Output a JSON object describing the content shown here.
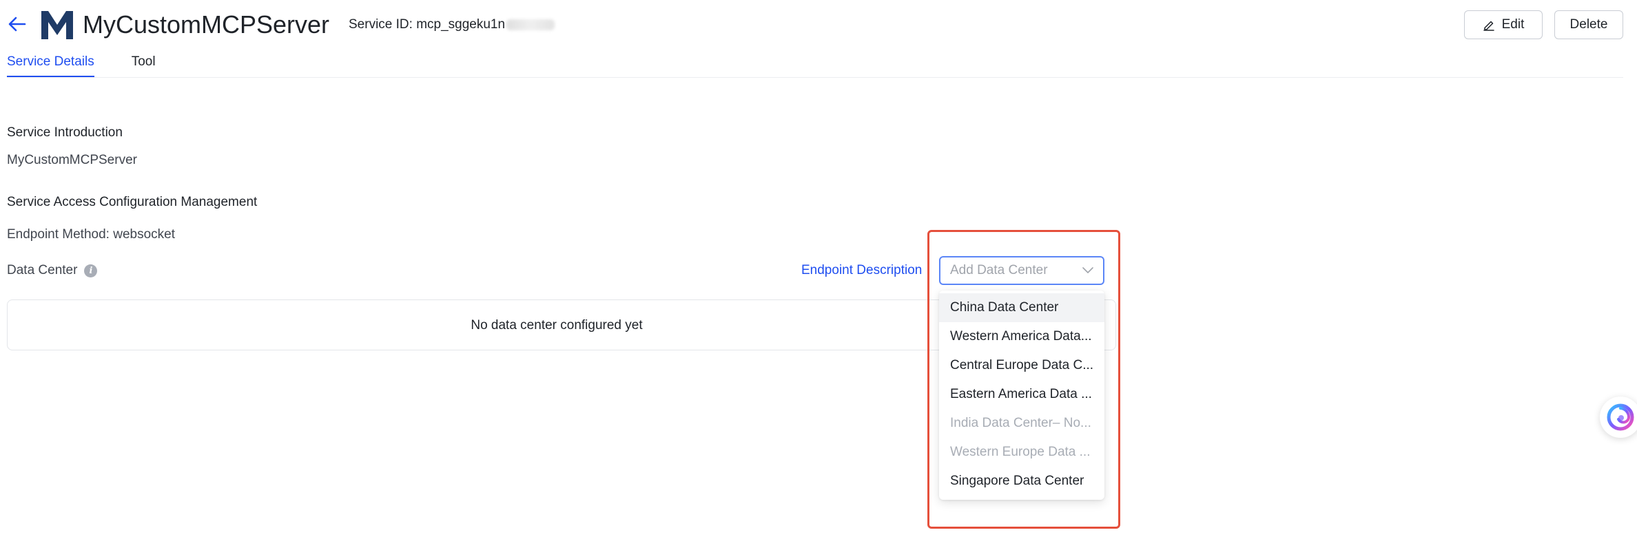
{
  "header": {
    "title": "MyCustomMCPServer",
    "service_id_label": "Service ID: mcp_sggeku1n",
    "logo_letter": "M",
    "edit_label": "Edit",
    "delete_label": "Delete"
  },
  "tabs": [
    {
      "label": "Service Details",
      "active": true
    },
    {
      "label": "Tool",
      "active": false
    }
  ],
  "service_intro": {
    "title": "Service Introduction",
    "value": "MyCustomMCPServer"
  },
  "access_config": {
    "title": "Service Access Configuration Management",
    "endpoint_method": "Endpoint Method: websocket",
    "data_center_label": "Data Center",
    "endpoint_description_link": "Endpoint Description",
    "empty_text": "No data center configured yet"
  },
  "data_center_select": {
    "placeholder": "Add Data Center",
    "options": [
      {
        "label": "China Data Center",
        "disabled": false,
        "hover": true
      },
      {
        "label": "Western America Data...",
        "disabled": false,
        "hover": false
      },
      {
        "label": "Central Europe Data C...",
        "disabled": false,
        "hover": false
      },
      {
        "label": "Eastern America Data ...",
        "disabled": false,
        "hover": false
      },
      {
        "label": "India Data Center– No...",
        "disabled": true,
        "hover": false
      },
      {
        "label": "Western Europe Data ...",
        "disabled": true,
        "hover": false
      },
      {
        "label": "Singapore Data Center",
        "disabled": false,
        "hover": false
      }
    ]
  },
  "colors": {
    "accent": "#1f4ef0",
    "logo": "#1f3b66",
    "highlight": "#e5503c"
  },
  "icons": {
    "back": "arrow-left-icon",
    "edit": "pencil-icon",
    "info": "info-icon",
    "chevron": "chevron-down-icon",
    "assistant": "assistant-swirl-icon"
  }
}
